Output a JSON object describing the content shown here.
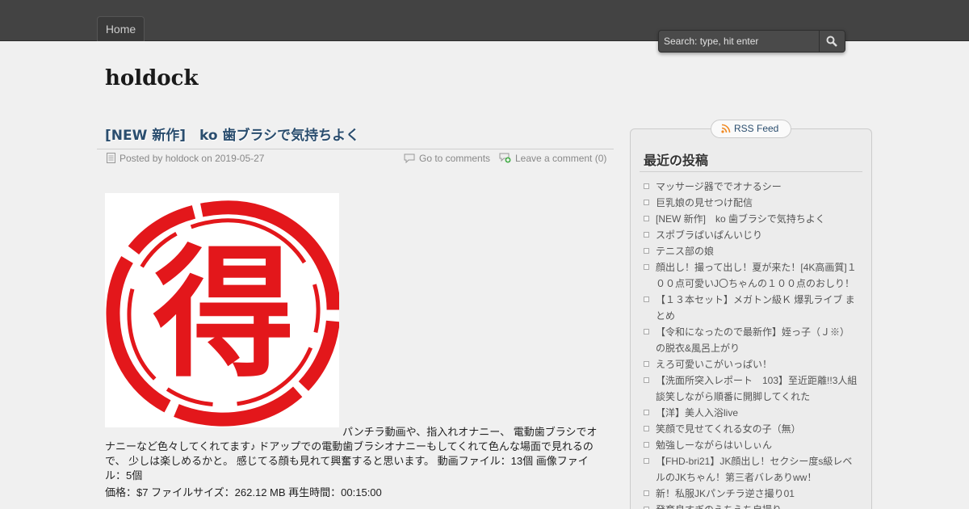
{
  "nav": {
    "home_label": "Home"
  },
  "search": {
    "placeholder": "Search: type, hit enter"
  },
  "site": {
    "title": "holdock"
  },
  "post": {
    "title": "[NEW 新作]　ko 歯ブラシで気持ちよく",
    "meta_posted": "Posted by holdock on 2019-05-27",
    "meta_comments": "Go to comments",
    "meta_leave": "Leave a comment (0)",
    "image_char": "得",
    "body": "パンチラ動画や、指入れオナニー、 電動歯ブラシでオナニーなど色々してくれてます♪ ドアップでの電動歯ブラシオナニーもしてくれて色んな場面で見れるので、 少しは楽しめるかと。 感じてる顔も見れて興奮すると思います。 動画ファイル：13個 画像ファイル：5個",
    "price_line": "価格：$7 ファイルサイズ：262.12 MB 再生時間：00:15:00"
  },
  "sidebar": {
    "rss_label": "RSS Feed",
    "widget_title": "最近の投稿",
    "recent_posts": [
      "マッサージ器ででオナるシー",
      "巨乳娘の見せつけ配信",
      "[NEW 新作]　ko 歯ブラシで気持ちよく",
      "スポブラぱいぱんいじり",
      "テニス部の娘",
      "顔出し！撮って出し！夏が来た！[4K高画質]１００点可愛いJ〇ちゃんの１００点のおしり！",
      "【１３本セット】メガトン級Ｋ 爆乳ライブ まとめ",
      "【令和になったので最新作】姪っ子（Ｊ※）の脱衣&風呂上がり",
      "えろ可愛いこがいっぱい！",
      "【洗面所突入レポート　103】至近距離!!3人組　談笑しながら順番に開脚してくれた",
      "【洋】美人入浴live",
      "笑顔で見せてくれる女の子（無）",
      "勉強しーながらはいしぃん",
      "【FHD-bri21】JK顔出し！セクシー度s級レベルのJKちゃん！第三者バレありww！",
      "新！私服JKパンチラ逆さ撮り01",
      "発育良すぎのえちえち自撮り"
    ]
  },
  "colors": {
    "topbar": "#434343",
    "link": "#2a4d6e",
    "seal_red": "#e3171b"
  }
}
